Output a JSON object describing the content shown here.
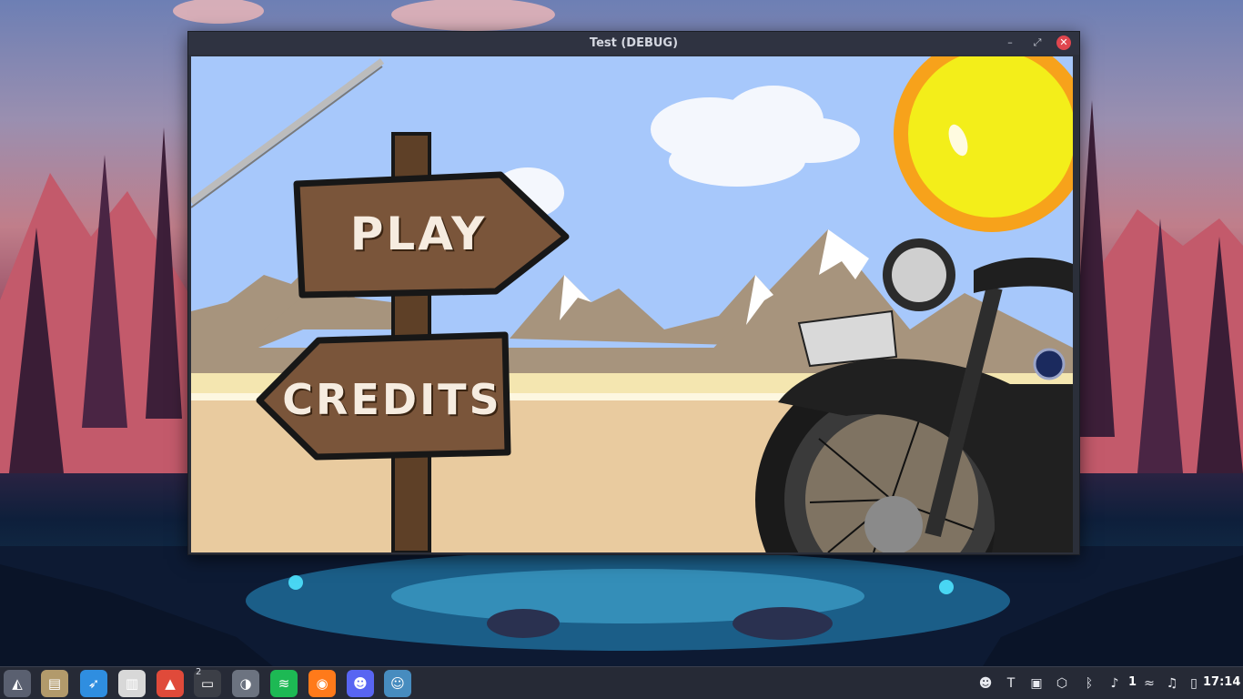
{
  "window": {
    "title": "Test (DEBUG)",
    "minimize_glyph": "–",
    "maximize_glyph": "⤢",
    "close_glyph": "✕"
  },
  "game": {
    "play_label": "PLAY",
    "credits_label": "CREDITS"
  },
  "taskbar": {
    "apps": [
      {
        "name": "launcher-icon",
        "glyph": "◭",
        "color": "#5a6070"
      },
      {
        "name": "files-icon",
        "glyph": "▤",
        "color": "#b29a6b"
      },
      {
        "name": "browser-compass-icon",
        "glyph": "➶",
        "color": "#2f8ee0"
      },
      {
        "name": "archive-icon",
        "glyph": "▥",
        "color": "#d8d8d8"
      },
      {
        "name": "rocket-app-icon",
        "glyph": "▲",
        "color": "#e04a3a"
      },
      {
        "name": "terminal-icon",
        "glyph": "▭",
        "color": "#3c3f47"
      },
      {
        "name": "app-sphere-icon",
        "glyph": "◑",
        "color": "#6c7380"
      },
      {
        "name": "spotify-icon",
        "glyph": "≋",
        "color": "#1db954"
      },
      {
        "name": "firefox-icon",
        "glyph": "◉",
        "color": "#ff7a1a"
      },
      {
        "name": "discord-icon",
        "glyph": "☻",
        "color": "#5865f2"
      },
      {
        "name": "godot-icon",
        "glyph": "☺",
        "color": "#478cbf"
      }
    ],
    "terminal_badge": "2",
    "tray": [
      {
        "name": "discord-tray-icon",
        "glyph": "☻"
      },
      {
        "name": "teams-tray-icon",
        "glyph": "T"
      },
      {
        "name": "clipboard-tray-icon",
        "glyph": "▣"
      },
      {
        "name": "package-tray-icon",
        "glyph": "⬡"
      },
      {
        "name": "bluetooth-tray-icon",
        "glyph": "ᛒ"
      },
      {
        "name": "notification-tray-icon",
        "glyph": "♪"
      },
      {
        "name": "wifi-tray-icon",
        "glyph": "≈"
      },
      {
        "name": "music-tray-icon",
        "glyph": "♫"
      },
      {
        "name": "battery-tray-icon",
        "glyph": "▯"
      }
    ],
    "notification_count": "1",
    "clock": "17:14"
  }
}
